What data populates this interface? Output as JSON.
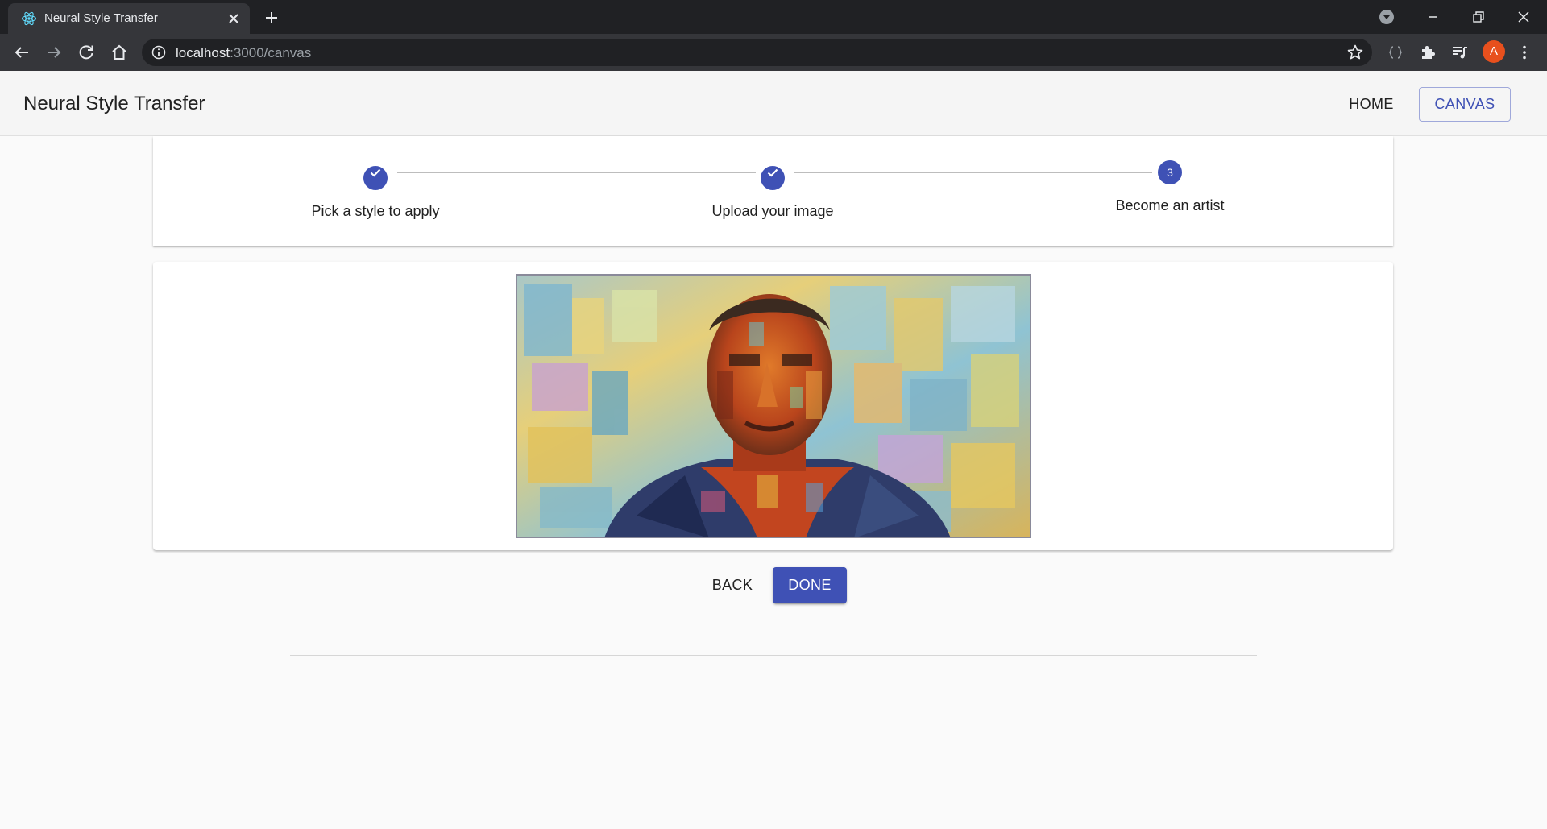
{
  "browser": {
    "tab_title": "Neural Style Transfer",
    "url_host": "localhost",
    "url_path": ":3000/canvas",
    "profile_initial": "A"
  },
  "appbar": {
    "title": "Neural Style Transfer",
    "nav": {
      "home": "HOME",
      "canvas": "CANVAS"
    }
  },
  "stepper": {
    "steps": [
      {
        "label": "Pick a style to apply",
        "state": "completed"
      },
      {
        "label": "Upload your image",
        "state": "completed"
      },
      {
        "label": "Become an artist",
        "state": "active",
        "number": "3"
      }
    ]
  },
  "actions": {
    "back": "BACK",
    "done": "DONE"
  },
  "colors": {
    "primary": "#3f51b5",
    "chrome_dark": "#202124",
    "chrome_toolbar": "#35363a",
    "avatar": "#e8501d"
  },
  "icons": [
    "react-favicon-icon",
    "close-icon",
    "plus-icon",
    "arrow-back-icon",
    "arrow-forward-icon",
    "reload-icon",
    "home-icon",
    "info-icon",
    "star-icon",
    "extensions-icon",
    "media-icon",
    "menu-dots-icon",
    "check-icon"
  ]
}
